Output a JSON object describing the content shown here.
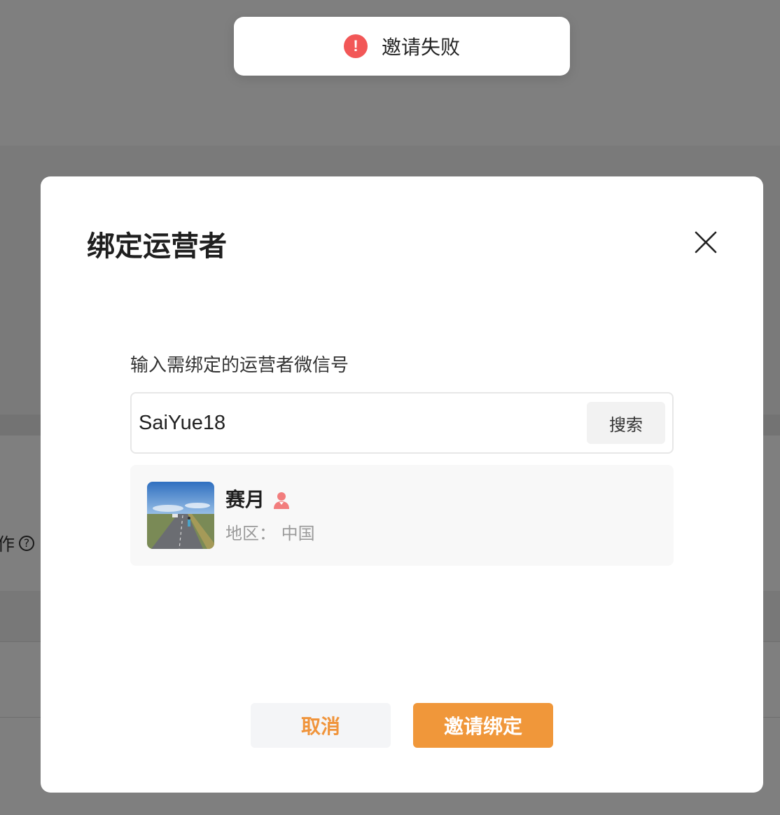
{
  "toast": {
    "icon": "error-icon",
    "message": "邀请失败",
    "icon_color": "#f25757"
  },
  "background": {
    "partial_label": "作",
    "help_icon": "question-circle-icon",
    "help_glyph": "?"
  },
  "dialog": {
    "title": "绑定运营者",
    "close_icon": "close-icon",
    "field_label": "输入需绑定的运营者微信号",
    "search_input_value": "SaiYue18",
    "search_button_label": "搜索",
    "result": {
      "avatar": "avatar-photo",
      "name": "赛月",
      "gender_icon": "female-user-icon",
      "gender_color": "#f27d7d",
      "region": "地区：  中国"
    },
    "cancel_label": "取消",
    "invite_label": "邀请绑定"
  },
  "colors": {
    "accent": "#f0973a",
    "overlay": "rgba(0,0,0,0.5)"
  }
}
